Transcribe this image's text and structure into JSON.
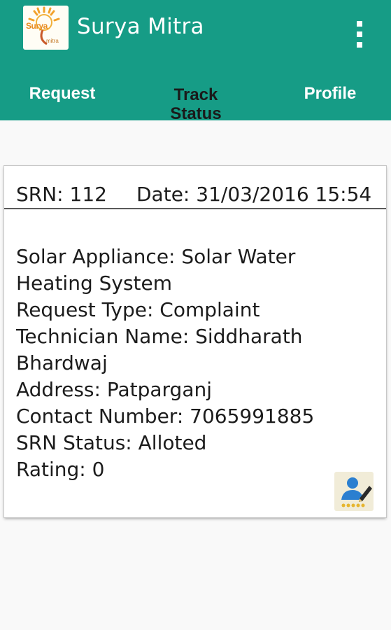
{
  "app": {
    "title": "Surya Mitra",
    "logo_text_primary": "Surya",
    "logo_text_secondary": "mitra",
    "accent_color": "#169c86"
  },
  "tabs": [
    {
      "label": "Request",
      "selected": false
    },
    {
      "label": "Track Status",
      "selected": true
    },
    {
      "label": "Profile",
      "selected": false
    }
  ],
  "card": {
    "srn": "SRN: 112",
    "date": "Date: 31/03/2016 15:54",
    "details": [
      "Solar Appliance: Solar Water Heating System",
      "Request Type: Complaint",
      "Technician Name: Siddharath Bhardwaj",
      "Address: Patparganj",
      "Contact Number: 7065991885",
      "SRN Status: Alloted",
      "Rating: 0"
    ],
    "rate_icon": "rate-technician-icon"
  },
  "icons": {
    "menu": "overflow-menu-icon"
  }
}
